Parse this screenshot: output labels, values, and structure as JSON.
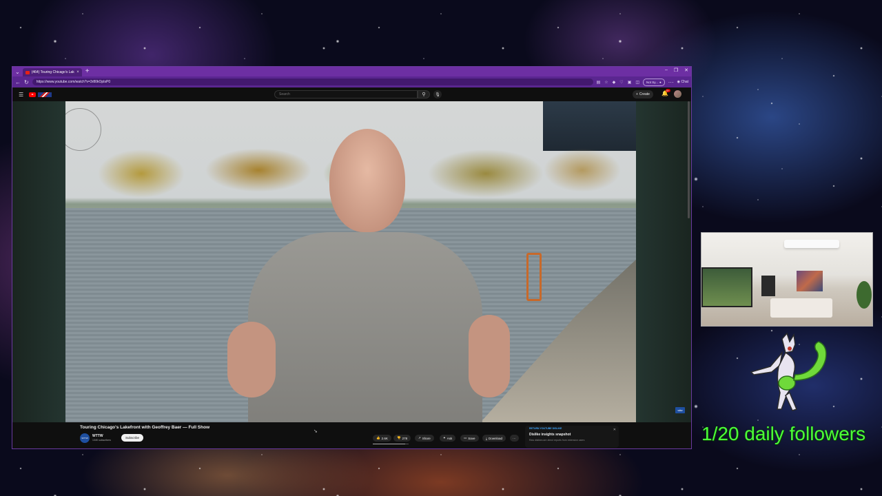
{
  "browser": {
    "tab_title": "(464) Touring Chicago's Lakefr...",
    "new_tab": "+",
    "url": "https://www.youtube.com/watch?v=3r80kOpIsP0",
    "not_syncing": "Not Sy...",
    "chat": "Chat",
    "win_min": "–",
    "win_max": "❐",
    "win_close": "✕"
  },
  "youtube": {
    "search_placeholder": "Search",
    "create_label": "Create",
    "notif_count": "9+"
  },
  "video": {
    "title": "Touring Chicago's Lakefront with Geoffrey Baer — Full Show",
    "watermark": "wttw"
  },
  "channel": {
    "name": "WTTW",
    "subscribers": "134K subscribers",
    "avatar_text": "WTTW",
    "subscribe_label": "Subscribe"
  },
  "actions": {
    "likes": "2.6K",
    "dislikes": "278",
    "share": "Share",
    "ask": "Ask",
    "save": "Save",
    "download": "Download",
    "more": "···",
    "like_ratio": 0.9
  },
  "ryd_panel": {
    "label": "RETURN YOUTUBE DISLIKE",
    "heading": "Dislike insights snapshot",
    "subtext": "Raw dislikes are direct reports from extension users",
    "close": "✕"
  },
  "overlay": {
    "followers_text": "1/20 daily followers"
  },
  "colors": {
    "browser_accent": "#6d2fa3",
    "youtube_red": "#ff0000",
    "followers_green": "#4cff3a"
  }
}
